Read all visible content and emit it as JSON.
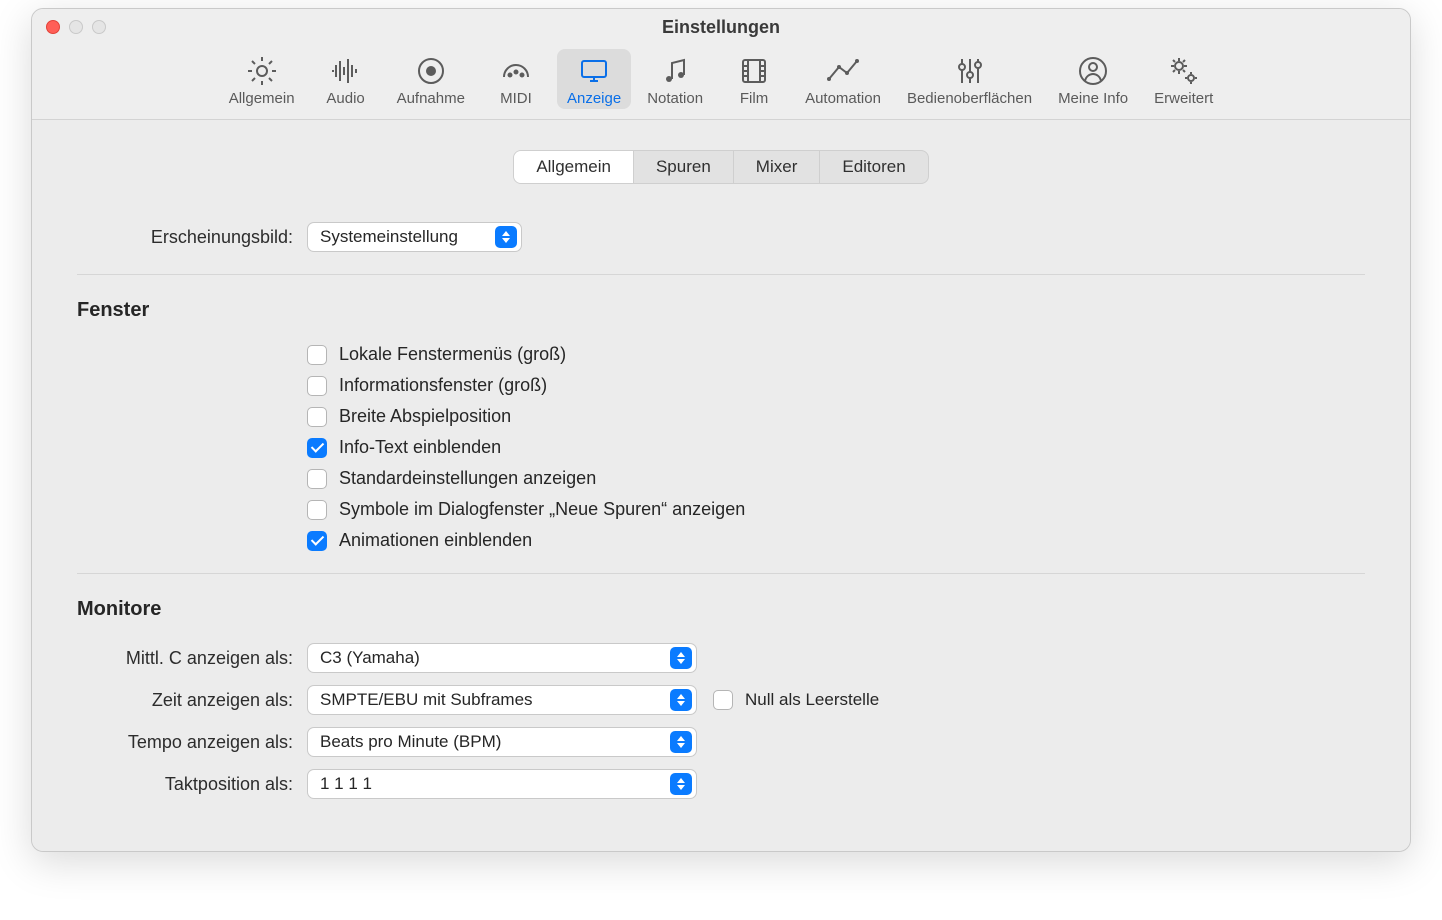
{
  "window_title": "Einstellungen",
  "toolbar": [
    {
      "icon": "gear",
      "label": "Allgemein"
    },
    {
      "icon": "audio",
      "label": "Audio"
    },
    {
      "icon": "record",
      "label": "Aufnahme"
    },
    {
      "icon": "midi",
      "label": "MIDI"
    },
    {
      "icon": "display",
      "label": "Anzeige",
      "selected": true
    },
    {
      "icon": "notation",
      "label": "Notation"
    },
    {
      "icon": "film",
      "label": "Film"
    },
    {
      "icon": "automation",
      "label": "Automation"
    },
    {
      "icon": "sliders",
      "label": "Bedienoberflächen"
    },
    {
      "icon": "user",
      "label": "Meine Info"
    },
    {
      "icon": "gears",
      "label": "Erweitert"
    }
  ],
  "subtabs": [
    "Allgemein",
    "Spuren",
    "Mixer",
    "Editoren"
  ],
  "subtab_active": 0,
  "appearance": {
    "label": "Erscheinungsbild:",
    "value": "Systemeinstellung"
  },
  "section_fenster": "Fenster",
  "checks": [
    {
      "label": "Lokale Fenstermenüs (groß)",
      "checked": false
    },
    {
      "label": "Informationsfenster (groß)",
      "checked": false
    },
    {
      "label": "Breite Abspielposition",
      "checked": false
    },
    {
      "label": "Info-Text einblenden",
      "checked": true
    },
    {
      "label": "Standardeinstellungen anzeigen",
      "checked": false
    },
    {
      "label": "Symbole im Dialogfenster „Neue Spuren“ anzeigen",
      "checked": false
    },
    {
      "label": "Animationen einblenden",
      "checked": true
    }
  ],
  "section_monitore": "Monitore",
  "monitors": {
    "middle_c": {
      "label": "Mittl. C anzeigen als:",
      "value": "C3 (Yamaha)"
    },
    "time": {
      "label": "Zeit anzeigen als:",
      "value": "SMPTE/EBU mit Subframes",
      "extra_check": "Null als Leerstelle",
      "extra_checked": false
    },
    "tempo": {
      "label": "Tempo anzeigen als:",
      "value": "Beats pro Minute (BPM)"
    },
    "bar": {
      "label": "Taktposition als:",
      "value": "1 1 1 1"
    }
  }
}
